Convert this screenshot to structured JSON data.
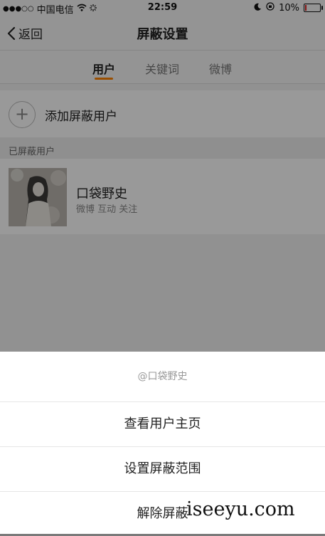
{
  "status_bar": {
    "signal_dots": "●●●○○",
    "carrier": "中国电信",
    "time": "22:59",
    "battery_percent": "10%",
    "battery_level": 0.1
  },
  "navbar": {
    "back_label": "返回",
    "title": "屏蔽设置"
  },
  "tabs": [
    {
      "label": "用户",
      "active": true
    },
    {
      "label": "关键词",
      "active": false
    },
    {
      "label": "微博",
      "active": false
    }
  ],
  "add_row": {
    "label": "添加屏蔽用户"
  },
  "blocked_section": {
    "title": "已屏蔽用户"
  },
  "blocked_user": {
    "name": "口袋野史",
    "subtitle": "微博 互动 关注"
  },
  "action_sheet": {
    "title": "@口袋野史",
    "items": [
      {
        "label": "查看用户主页"
      },
      {
        "label": "设置屏蔽范围"
      },
      {
        "label": "解除屏蔽"
      }
    ]
  },
  "watermark": "iseeyu.com",
  "colors": {
    "accent": "#ff8200",
    "battery_low": "#e02020"
  }
}
